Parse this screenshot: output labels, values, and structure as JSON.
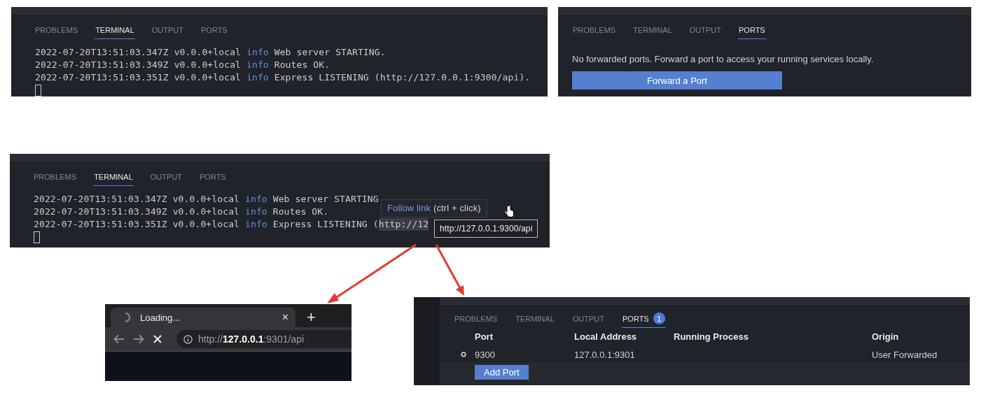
{
  "terminal_panel": {
    "tabs": [
      {
        "label": "PROBLEMS",
        "selected": false
      },
      {
        "label": "TERMINAL",
        "selected": true
      },
      {
        "label": "OUTPUT",
        "selected": false
      },
      {
        "label": "PORTS",
        "selected": false
      }
    ],
    "lines": [
      {
        "timestamp": "2022-07-20T13:51:03.347Z",
        "version": "v0.0.0+local",
        "level": "info",
        "message": "Web server STARTING."
      },
      {
        "timestamp": "2022-07-20T13:51:03.349Z",
        "version": "v0.0.0+local",
        "level": "info",
        "message": "Routes OK."
      },
      {
        "timestamp": "2022-07-20T13:51:03.351Z",
        "version": "v0.0.0+local",
        "level": "info",
        "message": "Express LISTENING (http://127.0.0.1:9300/api)."
      }
    ]
  },
  "ports_empty_panel": {
    "tabs": [
      {
        "label": "PROBLEMS",
        "selected": false
      },
      {
        "label": "TERMINAL",
        "selected": false
      },
      {
        "label": "OUTPUT",
        "selected": false
      },
      {
        "label": "PORTS",
        "selected": true
      }
    ],
    "message": "No forwarded ports. Forward a port to access your running services locally.",
    "button": "Forward a Port"
  },
  "terminal_hover_panel": {
    "tabs": [
      {
        "label": "PROBLEMS",
        "selected": false
      },
      {
        "label": "TERMINAL",
        "selected": true
      },
      {
        "label": "OUTPUT",
        "selected": false
      },
      {
        "label": "PORTS",
        "selected": false
      }
    ],
    "lines": [
      {
        "timestamp": "2022-07-20T13:51:03.347Z",
        "version": "v0.0.0+local",
        "level": "info",
        "message": "Web server STARTING"
      },
      {
        "timestamp": "2022-07-20T13:51:03.349Z",
        "version": "v0.0.0+local",
        "level": "info",
        "message": "Routes OK."
      },
      {
        "timestamp": "2022-07-20T13:51:03.351Z",
        "version": "v0.0.0+local",
        "level": "info",
        "message": "Express LISTENING (",
        "link": "http://12"
      }
    ],
    "hover_tooltip": {
      "action": "Follow link",
      "hint": "(ctrl + click)"
    },
    "url_tooltip": "http://127.0.0.1:9300/api"
  },
  "browser": {
    "tab_title": "Loading...",
    "tab_close": "×",
    "new_tab": "+",
    "address": "http://**127.0.0.1**:9301/api"
  },
  "ports_panel": {
    "tabs": [
      {
        "label": "PROBLEMS",
        "selected": false
      },
      {
        "label": "TERMINAL",
        "selected": false
      },
      {
        "label": "OUTPUT",
        "selected": false
      },
      {
        "label": "PORTS",
        "selected": true,
        "badge": "1"
      }
    ],
    "columns": [
      "Port",
      "Local Address",
      "Running Process",
      "Origin"
    ],
    "rows": [
      {
        "port": "9300",
        "local_address": "127.0.0.1:9301",
        "origin": "User Forwarded"
      }
    ],
    "button": "Add Port"
  }
}
